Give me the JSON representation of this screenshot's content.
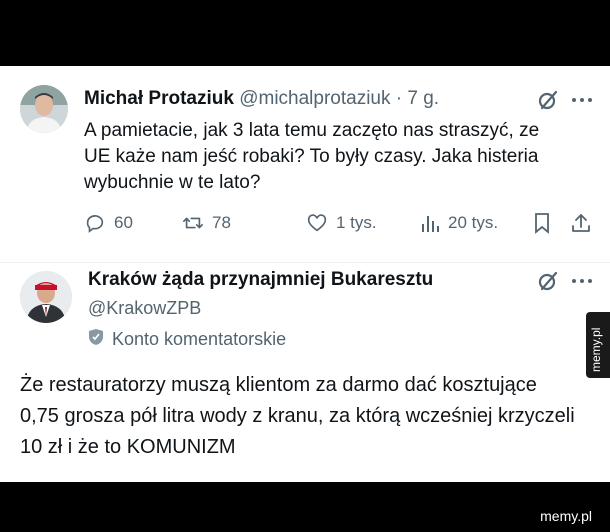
{
  "tweet1": {
    "author_name": "Michał Protaziuk",
    "handle": "@michalprotaziuk",
    "separator": " · ",
    "time": "7 g.",
    "text": "A pamietacie, jak 3 lata temu zaczęto nas straszyć, ze UE każe nam jeść robaki? To były czasy. Jaka histeria wybuchnie w te lato?",
    "actions": {
      "replies": "60",
      "retweets": "78",
      "likes": "1 tys.",
      "views": "20 tys."
    }
  },
  "tweet2": {
    "author_name": "Kraków żąda przynajmniej Bukaresztu",
    "handle": "@KrakowZPB",
    "badge_label": "Konto komentatorskie",
    "text": "Że restauratorzy muszą klientom za darmo dać kosztujące 0,75 grosza pół litra wody z kranu, za którą wcześniej krzyczeli 10 zł i że to KOMUNIZM"
  },
  "watermark": {
    "side": "memy.pl",
    "bottom": "memy.pl"
  },
  "icons": {
    "grok": "grok-icon",
    "more": "more-dots-icon",
    "reply": "reply-icon",
    "retweet": "retweet-icon",
    "like": "heart-icon",
    "views": "views-icon",
    "bookmark": "bookmark-icon",
    "share": "share-icon",
    "badge": "shield-icon"
  },
  "colors": {
    "background": "#000000",
    "card": "#ffffff",
    "text": "#0f1419",
    "secondary": "#536471"
  }
}
